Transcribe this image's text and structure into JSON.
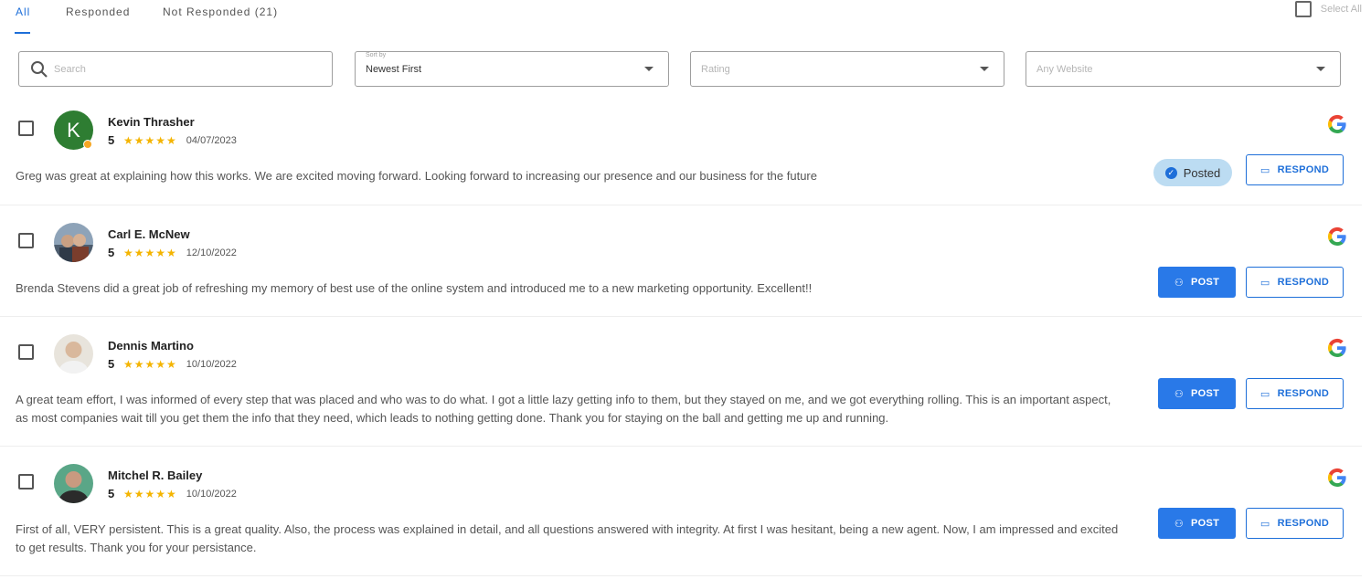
{
  "tabs": [
    {
      "label": "All",
      "active": true
    },
    {
      "label": "Responded",
      "active": false
    },
    {
      "label": "Not Responded (21)",
      "active": false
    }
  ],
  "select_all": {
    "label": "Select All",
    "checked": false
  },
  "filters": {
    "search_placeholder": "Search",
    "sort_floating_label": "Sort by",
    "sort_value": "Newest First",
    "rating_placeholder": "Rating",
    "website_placeholder": "Any Website"
  },
  "buttons": {
    "respond": "RESPOND",
    "post": "POST",
    "posted": "Posted"
  },
  "colors": {
    "accent": "#1e6fd9",
    "post_bg": "#2979e8",
    "posted_bg": "#bcdcf2",
    "star": "#f4b400"
  },
  "reviews": [
    {
      "name": "Kevin Thrasher",
      "rating": "5",
      "stars": "★★★★★",
      "date": "04/07/2023",
      "text": "Greg was great at explaining how this works. We are excited moving forward. Looking forward to increasing our presence and our business for the future",
      "avatar_initial": "K",
      "source_icon": "google-icon",
      "status": "posted"
    },
    {
      "name": "Carl E. McNew",
      "rating": "5",
      "stars": "★★★★★",
      "date": "12/10/2022",
      "text": "Brenda Stevens did a great job of refreshing my memory of best use of the online system and introduced me to a new marketing opportunity. Excellent!!",
      "source_icon": "google-icon",
      "status": "not-posted"
    },
    {
      "name": "Dennis Martino",
      "rating": "5",
      "stars": "★★★★★",
      "date": "10/10/2022",
      "text": "A great team effort, I was informed of every step that was placed and who was to do what. I got a little lazy getting info to them, but they stayed on me, and we got everything rolling. This is an important aspect, as most companies wait till you get them the info that they need, which leads to nothing getting done. Thank you for staying on the ball and getting me up and running.",
      "source_icon": "google-icon",
      "status": "not-posted"
    },
    {
      "name": "Mitchel R. Bailey",
      "rating": "5",
      "stars": "★★★★★",
      "date": "10/10/2022",
      "text": "First of all, VERY persistent. This is a great quality. Also, the process was explained in detail, and all questions answered with integrity. At first I was hesitant, being a new agent. Now, I am impressed and excited to get results. Thank you for your persistance.",
      "source_icon": "google-icon",
      "status": "not-posted"
    }
  ]
}
